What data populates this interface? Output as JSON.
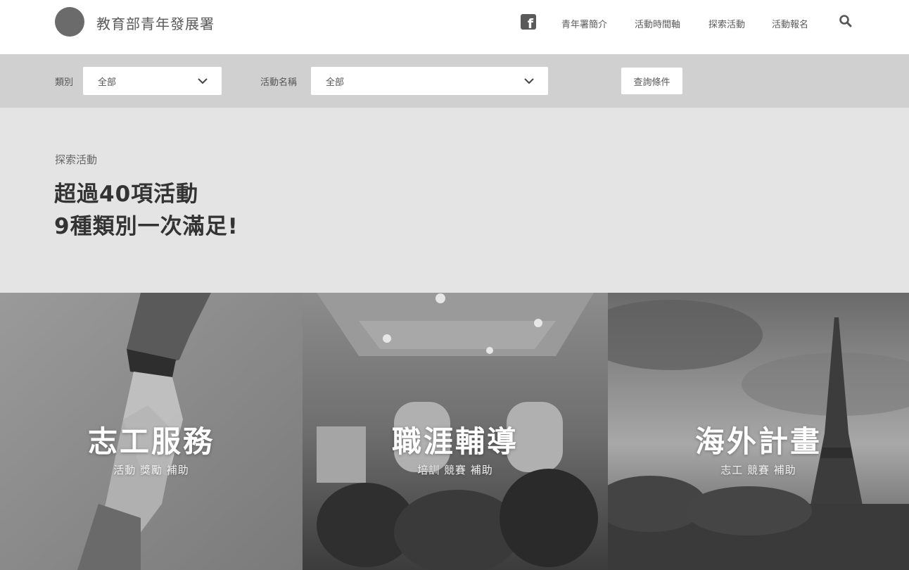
{
  "header": {
    "site_title": "教育部青年發展署",
    "nav": [
      {
        "label": "青年署簡介"
      },
      {
        "label": "活動時間軸"
      },
      {
        "label": "探索活動"
      },
      {
        "label": "活動報名"
      }
    ],
    "facebook_icon": "facebook-icon",
    "search_icon": "search-icon"
  },
  "filters": {
    "category_label": "類別",
    "category_value": "全部",
    "activity_label": "活動名稱",
    "activity_value": "全部",
    "query_button": "查詢條件"
  },
  "intro": {
    "section_label": "探索活動",
    "headline_line1": "超過40項活動",
    "headline_line2": "9種類別一次滿足!"
  },
  "categories": [
    {
      "title": "志工服務",
      "tags": "活動 獎勵 補助"
    },
    {
      "title": "職涯輔導",
      "tags": "培訓 競賽 補助"
    },
    {
      "title": "海外計畫",
      "tags": "志工 競賽 補助"
    }
  ],
  "colors": {
    "header_bg": "#ffffff",
    "filter_bar_bg": "#d0d0d0",
    "intro_bg": "#e4e4e4",
    "text_dark": "#333333"
  }
}
